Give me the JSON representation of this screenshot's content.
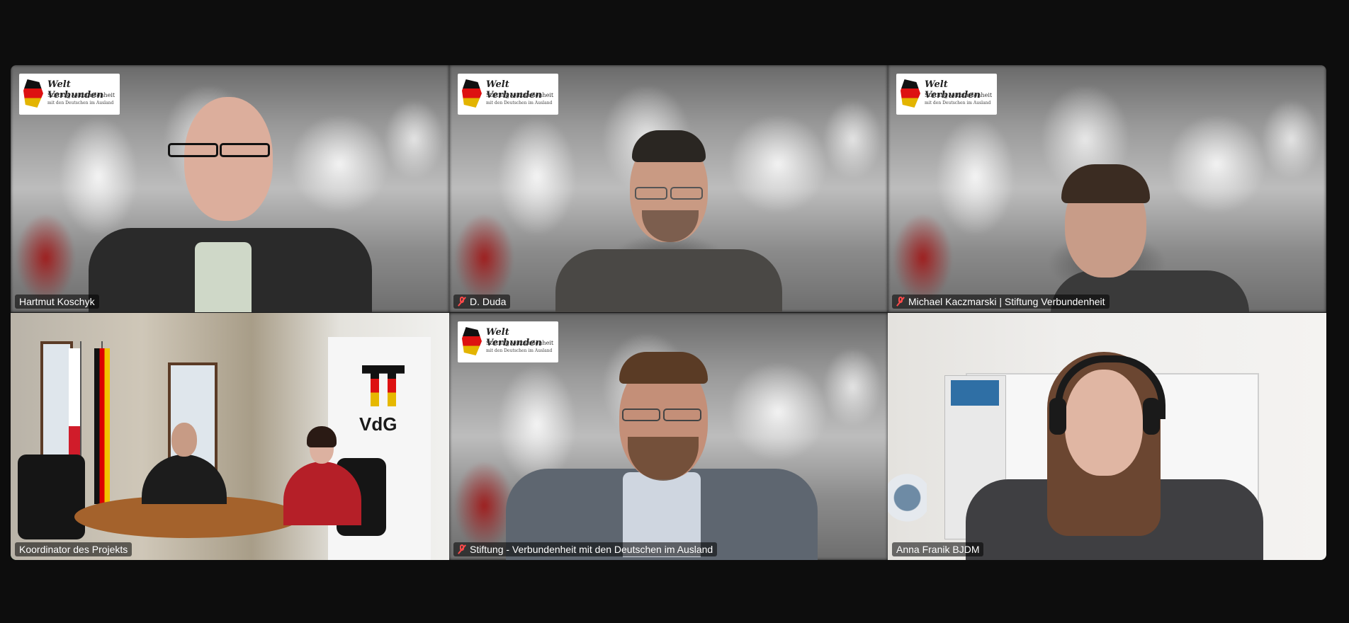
{
  "meeting": {
    "participants": [
      {
        "name": "Hartmut Koschyk",
        "muted": false,
        "logo": true,
        "active": false
      },
      {
        "name": "D. Duda",
        "muted": true,
        "logo": true,
        "active": false
      },
      {
        "name": "Michael Kaczmarski | Stiftung Verbundenheit",
        "muted": true,
        "logo": true,
        "active": false
      },
      {
        "name": "Koordinator des Projekts",
        "muted": false,
        "logo": false,
        "active": true
      },
      {
        "name": "Stiftung - Verbundenheit mit den Deutschen im Ausland",
        "muted": true,
        "logo": true,
        "active": false
      },
      {
        "name": "Anna Franik BJDM",
        "muted": false,
        "logo": false,
        "active": false
      }
    ]
  },
  "logo": {
    "script": "Welt Verbunden",
    "line1": "Stiftung Verbundenheit",
    "line2": "mit den Deutschen im Ausland"
  },
  "banner": {
    "title": "VdG"
  },
  "colors": {
    "active_border": "#2bd36b",
    "muted_icon": "#ff4a4a",
    "background": "#0d0d0d"
  }
}
